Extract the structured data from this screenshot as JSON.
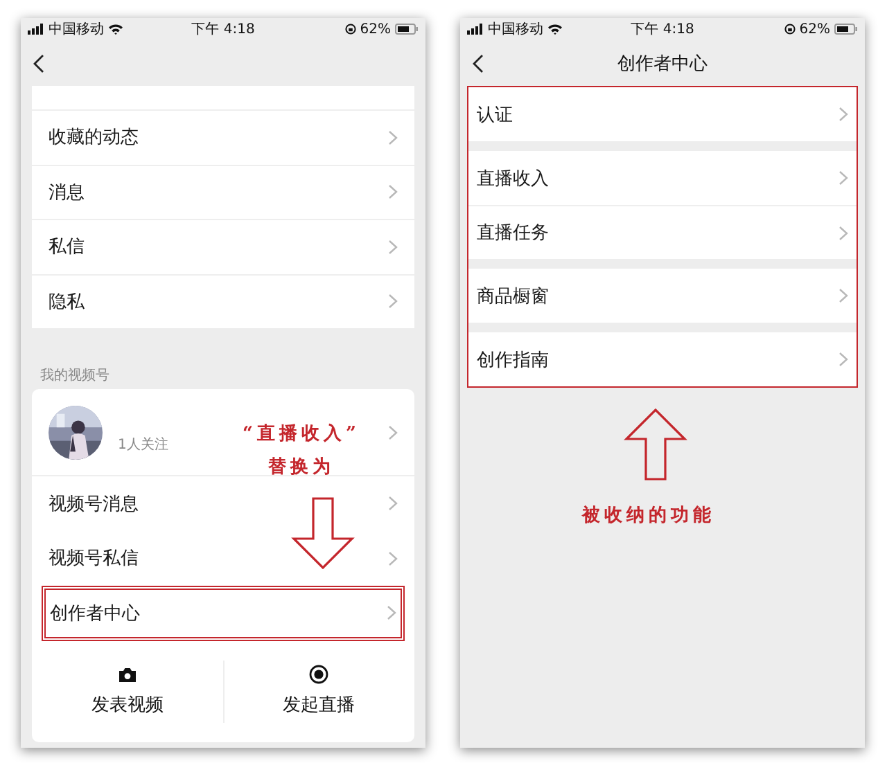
{
  "left": {
    "status_bar": {
      "carrier": "中国移动",
      "time": "下午 4:18",
      "battery": "62%"
    },
    "menu": [
      {
        "label": "收藏的动态"
      },
      {
        "label": "消息"
      },
      {
        "label": "私信"
      },
      {
        "label": "隐私"
      }
    ],
    "section_label": "我的视频号",
    "channel": {
      "followers": "1人关注",
      "items": [
        {
          "label": "视频号消息",
          "highlighted": false
        },
        {
          "label": "视频号私信",
          "highlighted": false
        },
        {
          "label": "创作者中心",
          "highlighted": true
        }
      ],
      "actions": [
        {
          "label": "发表视频",
          "kind": "camera"
        },
        {
          "label": "发起直播",
          "kind": "record"
        }
      ]
    },
    "note": [
      "“直播收入”",
      "替换为"
    ]
  },
  "right": {
    "status_bar": {
      "carrier": "中国移动",
      "time": "下午 4:18",
      "battery": "62%"
    },
    "title": "创作者中心",
    "groups": [
      {
        "items": [
          {
            "label": "认证"
          }
        ]
      },
      {
        "items": [
          {
            "label": "直播收入"
          },
          {
            "label": "直播任务"
          }
        ]
      },
      {
        "items": [
          {
            "label": "商品橱窗"
          }
        ]
      },
      {
        "items": [
          {
            "label": "创作指南"
          }
        ]
      }
    ],
    "note": "被收纳的功能"
  }
}
